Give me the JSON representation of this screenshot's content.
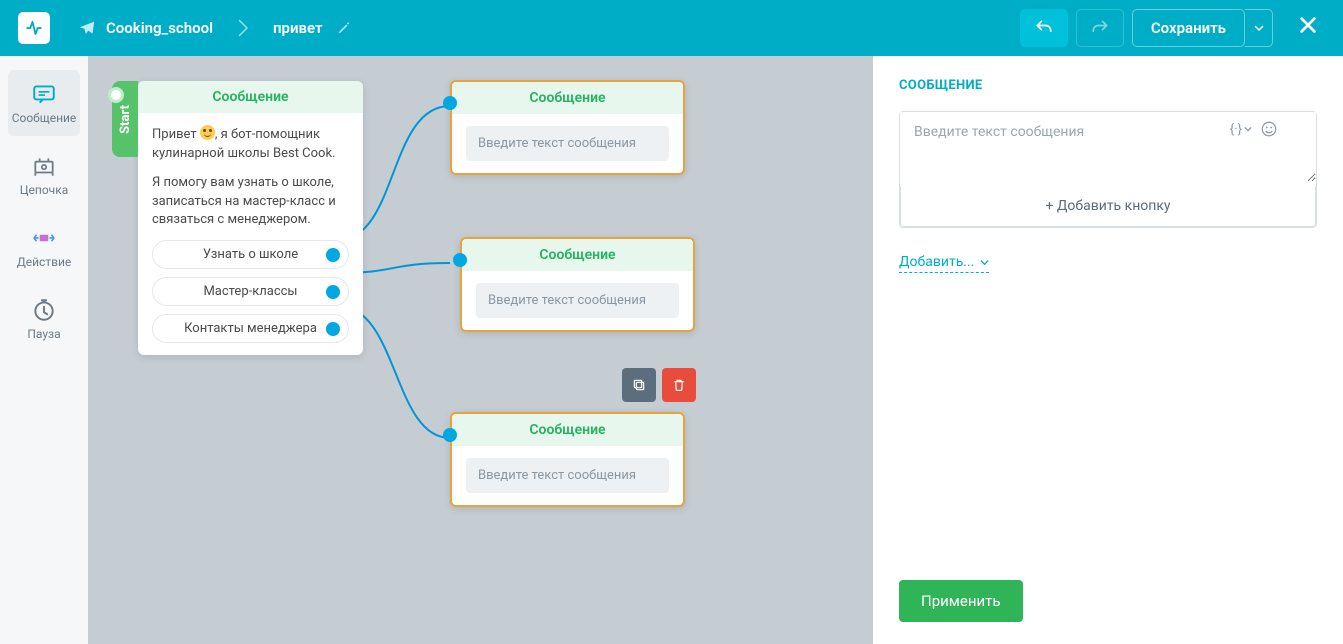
{
  "header": {
    "breadcrumb1": "Cooking_school",
    "breadcrumb2": "привет",
    "save": "Сохранить"
  },
  "sidebar": {
    "items": [
      {
        "label": "Сообщение"
      },
      {
        "label": "Цепочка"
      },
      {
        "label": "Действие"
      },
      {
        "label": "Пауза"
      }
    ]
  },
  "canvas": {
    "start_label": "Start",
    "node_title": "Сообщение",
    "msg_p1_a": "Привет ",
    "msg_p1_b": ", я бот-помощник кулинарной школы Best Cook.",
    "msg_p2": "Я помогу вам узнать о школе, записаться на мастер-класс и связаться с менеджером.",
    "options": [
      "Узнать о школе",
      "Мастер-классы",
      "Контакты менеджера"
    ],
    "placeholder": "Введите текст сообщения"
  },
  "panel": {
    "title": "СООБЩЕНИЕ",
    "ta_placeholder": "Введите текст сообщения",
    "var_btn": "{·}",
    "add_button": "+ Добавить кнопку",
    "add_link": "Добавить...",
    "apply": "Применить"
  }
}
